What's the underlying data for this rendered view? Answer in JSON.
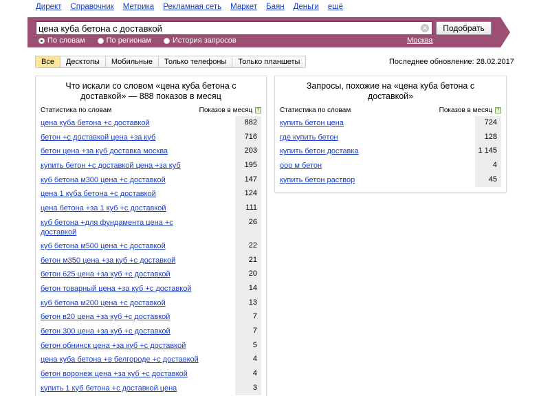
{
  "topnav": [
    "Директ",
    "Справочник",
    "Метрика",
    "Рекламная сеть",
    "Маркет",
    "Баян",
    "Деньги",
    "ещё"
  ],
  "search": {
    "query": "цена куба бетона с доставкой",
    "submit_label": "Подобрать",
    "modes": [
      {
        "label": "По словам",
        "selected": true
      },
      {
        "label": "По регионам",
        "selected": false
      },
      {
        "label": "История запросов",
        "selected": false
      }
    ],
    "region": "Москва"
  },
  "tabs": [
    {
      "label": "Все",
      "active": true
    },
    {
      "label": "Десктопы",
      "active": false
    },
    {
      "label": "Мобильные",
      "active": false
    },
    {
      "label": "Только телефоны",
      "active": false
    },
    {
      "label": "Только планшеты",
      "active": false
    }
  ],
  "last_update": {
    "label": "Последнее обновление:",
    "date": "28.02.2017"
  },
  "left_panel": {
    "title": "Что искали со словом «цена куба бетона с доставкой» — 888 показов в месяц",
    "col_keyword": "Статистика по словам",
    "col_count": "Показов в месяц",
    "help_icon": "?",
    "rows": [
      {
        "keyword": "цена куба бетона +с доставкой",
        "count": "882"
      },
      {
        "keyword": "бетон +с доставкой цена +за куб",
        "count": "716"
      },
      {
        "keyword": "бетон цена +за куб доставка москва",
        "count": "203"
      },
      {
        "keyword": "купить бетон +с доставкой цена +за куб",
        "count": "195"
      },
      {
        "keyword": "куб бетона м300 цена +с доставкой",
        "count": "147"
      },
      {
        "keyword": "цена 1 куба бетона +с доставкой",
        "count": "124"
      },
      {
        "keyword": "цена бетона +за 1 куб +с доставкой",
        "count": "111"
      },
      {
        "keyword": "куб бетона +для фундамента цена +с доставкой",
        "count": "26"
      },
      {
        "keyword": "куб бетона м500 цена +с доставкой",
        "count": "22"
      },
      {
        "keyword": "бетон м350 цена +за куб +с доставкой",
        "count": "21"
      },
      {
        "keyword": "бетон 625 цена +за куб +с доставкой",
        "count": "20"
      },
      {
        "keyword": "бетон товарный цена +за куб +с доставкой",
        "count": "14"
      },
      {
        "keyword": "куб бетона м200 цена +с доставкой",
        "count": "13"
      },
      {
        "keyword": "бетон в20 цена +за куб +с доставкой",
        "count": "7"
      },
      {
        "keyword": "бетон 300 цена +за куб +с доставкой",
        "count": "7"
      },
      {
        "keyword": "бетон обнинск цена +за куб +с доставкой",
        "count": "5"
      },
      {
        "keyword": "цена куба бетона +в белгороде +с доставкой",
        "count": "4"
      },
      {
        "keyword": "бетон воронеж цена +за куб +с доставкой",
        "count": "4"
      },
      {
        "keyword": "купить 1 куб бетона +с доставкой цена",
        "count": "3"
      }
    ]
  },
  "right_panel": {
    "title": "Запросы, похожие на «цена куба бетона с доставкой»",
    "col_keyword": "Статистика по словам",
    "col_count": "Показов в месяц",
    "help_icon": "?",
    "rows": [
      {
        "keyword": "купить бетон цена",
        "count": "724"
      },
      {
        "keyword": "где купить бетон",
        "count": "128"
      },
      {
        "keyword": "купить бетон доставка",
        "count": "1 145"
      },
      {
        "keyword": "ооо м бетон",
        "count": "4"
      },
      {
        "keyword": "купить бетон раствор",
        "count": "45"
      }
    ]
  }
}
